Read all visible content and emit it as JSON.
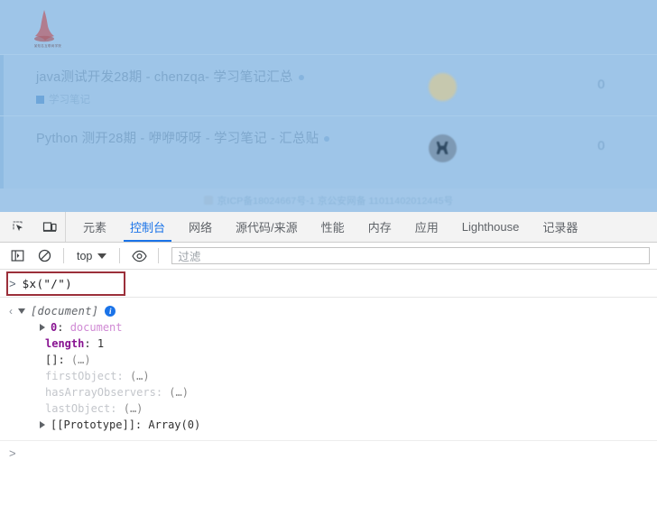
{
  "webpage": {
    "logo_caption": "某知名互联网学院",
    "rows": [
      {
        "title": "java测试开发28期 - chenzqa- 学习笔记汇总",
        "tag": "学习笔记",
        "avatar_kind": "light",
        "count": "0"
      },
      {
        "title": "Python 测开28期 - 咿咿呀呀 - 学习笔记 - 汇总贴",
        "tag": "",
        "avatar_kind": "dark",
        "count": "0"
      }
    ],
    "footer": {
      "icp": "京ICP备18024667号-1 京公安网备 11011402012445号"
    }
  },
  "devtools": {
    "toolbar_icons": [
      {
        "name": "inspect-element-icon",
        "title": "检查元素"
      },
      {
        "name": "device-toolbar-icon",
        "title": "切换设备工具栏"
      }
    ],
    "tabs": [
      {
        "label": "元素",
        "active": false
      },
      {
        "label": "控制台",
        "active": true
      },
      {
        "label": "网络",
        "active": false
      },
      {
        "label": "源代码/来源",
        "active": false
      },
      {
        "label": "性能",
        "active": false
      },
      {
        "label": "内存",
        "active": false
      },
      {
        "label": "应用",
        "active": false
      },
      {
        "label": "Lighthouse",
        "active": false
      },
      {
        "label": "记录器",
        "active": false
      }
    ],
    "console_toolbar": {
      "sidebar_toggle": "show-console-sidebar-icon",
      "clear_console": "clear-console-icon",
      "context_value": "top",
      "eye_icon": "live-expression-icon",
      "filter_placeholder": "过滤"
    },
    "console": {
      "input_expression": "$x(\"/\")",
      "prompt_symbol": ">",
      "return_symbol": "‹",
      "result_label": "[document]",
      "info_badge": "i",
      "properties": [
        {
          "key": "0",
          "sep": ":",
          "value": "document",
          "kind": "index",
          "expandable": true
        },
        {
          "key": "length",
          "sep": ":",
          "value": "1",
          "kind": "own",
          "expandable": false
        },
        {
          "key": "[]",
          "sep": ":",
          "value": "(…)",
          "kind": "own",
          "expandable": false
        },
        {
          "key": "firstObject",
          "sep": ":",
          "value": "(…)",
          "kind": "accessor",
          "expandable": false
        },
        {
          "key": "hasArrayObservers",
          "sep": ":",
          "value": "(…)",
          "kind": "accessor",
          "expandable": false
        },
        {
          "key": "lastObject",
          "sep": ":",
          "value": "(…)",
          "kind": "accessor",
          "expandable": false
        },
        {
          "key": "[[Prototype]]",
          "sep": ":",
          "value": "Array(0)",
          "kind": "proto",
          "expandable": true
        }
      ],
      "bottom_prompt_symbol": ">"
    },
    "highlight_color": "#9b2f3a",
    "accent_color": "#1a73e8"
  }
}
